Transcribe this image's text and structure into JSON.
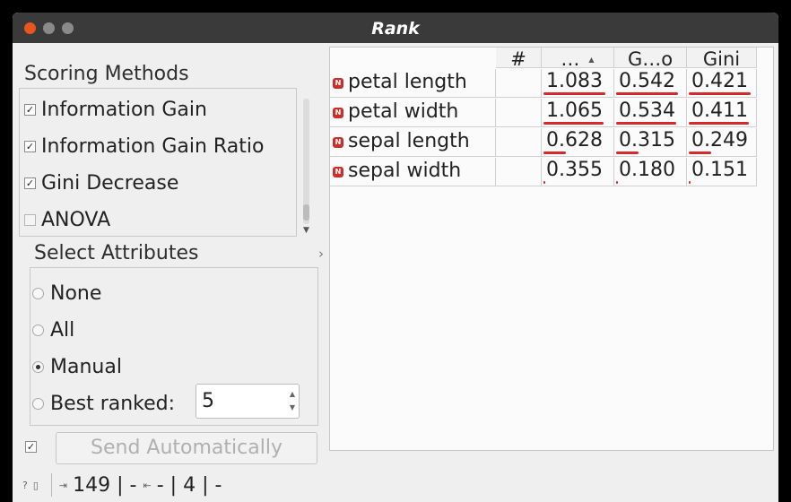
{
  "window": {
    "title": "Rank"
  },
  "scoring": {
    "label": "Scoring Methods",
    "items": [
      {
        "label": "Information Gain",
        "checked": true
      },
      {
        "label": "Information Gain Ratio",
        "checked": true
      },
      {
        "label": "Gini Decrease",
        "checked": true
      },
      {
        "label": "ANOVA",
        "checked": false
      }
    ]
  },
  "select_attributes": {
    "label": "Select Attributes",
    "options": [
      {
        "label": "None",
        "selected": false
      },
      {
        "label": "All",
        "selected": false
      },
      {
        "label": "Manual",
        "selected": true
      },
      {
        "label": "Best ranked:",
        "selected": false
      }
    ],
    "best_ranked_value": "5"
  },
  "send": {
    "label": "Send Automatically",
    "checked": true
  },
  "status": {
    "in_count": "149",
    "sep1": "|",
    "dash1": "-",
    "dash2": "-",
    "sep2": "|",
    "out_count": "4",
    "sep3": "|",
    "dash3": "-"
  },
  "table": {
    "headers": {
      "num": "#",
      "col1": "…",
      "col2": "G…o",
      "col3": "Gini"
    },
    "rows": [
      {
        "name": "petal length",
        "badge": "N",
        "v1": "1.083",
        "v2": "0.542",
        "v3": "0.421",
        "f1": 0.98,
        "f2": 0.98,
        "f3": 0.98
      },
      {
        "name": "petal width",
        "badge": "N",
        "v1": "1.065",
        "v2": "0.534",
        "v3": "0.411",
        "f1": 0.96,
        "f2": 0.96,
        "f3": 0.96
      },
      {
        "name": "sepal length",
        "badge": "N",
        "v1": "0.628",
        "v2": "0.315",
        "v3": "0.249",
        "f1": 0.35,
        "f2": 0.35,
        "f3": 0.35
      },
      {
        "name": "sepal width",
        "badge": "N",
        "v1": "0.355",
        "v2": "0.180",
        "v3": "0.151",
        "f1": 0.02,
        "f2": 0.02,
        "f3": 0.02
      }
    ]
  },
  "colors": {
    "accent": "#e95420",
    "bar": "#d42a2a",
    "badge": "#c9302c"
  }
}
